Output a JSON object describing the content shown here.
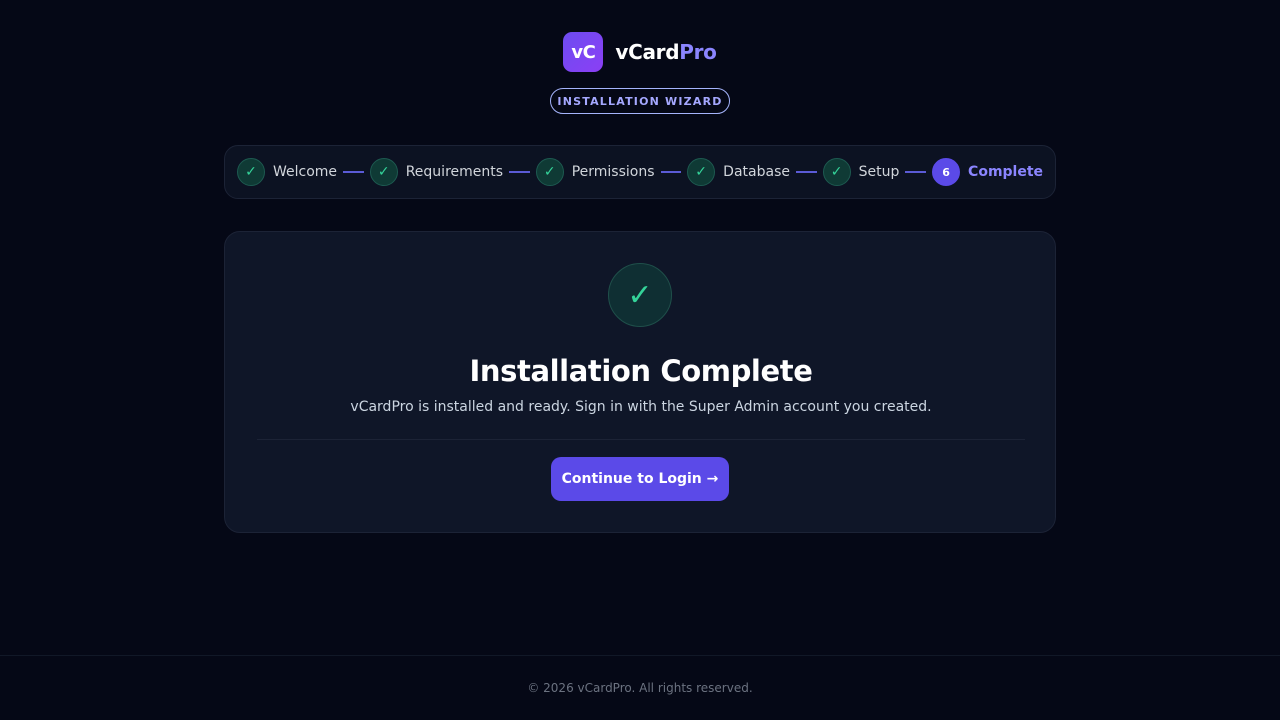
{
  "brand": {
    "logo_text": "vC",
    "name_part1": "vCard",
    "name_part2": "Pro",
    "logo_gradient": [
      "#6d4cf0",
      "#8b3ff5"
    ],
    "accent": "#8b85ff"
  },
  "wizard_badge": "INSTALLATION WIZARD",
  "stepper": {
    "steps": [
      {
        "label": "Welcome",
        "state": "done",
        "marker": "✓"
      },
      {
        "label": "Requirements",
        "state": "done",
        "marker": "✓"
      },
      {
        "label": "Permissions",
        "state": "done",
        "marker": "✓"
      },
      {
        "label": "Database",
        "state": "done",
        "marker": "✓"
      },
      {
        "label": "Setup",
        "state": "done",
        "marker": "✓"
      },
      {
        "label": "Complete",
        "state": "current",
        "marker": "6"
      }
    ],
    "done_icon": "check-icon",
    "done_color": "#34d399",
    "current_color": "#5b4ae8"
  },
  "card": {
    "icon": "✓",
    "icon_name": "success-check-icon",
    "title": "Installation Complete",
    "subtitle": "vCardPro is installed and ready. Sign in with the Super Admin account you created.",
    "button_label": "Continue to Login →",
    "button_color": "#5b4ae8"
  },
  "footer": {
    "text": "© 2026 vCardPro. All rights reserved."
  }
}
